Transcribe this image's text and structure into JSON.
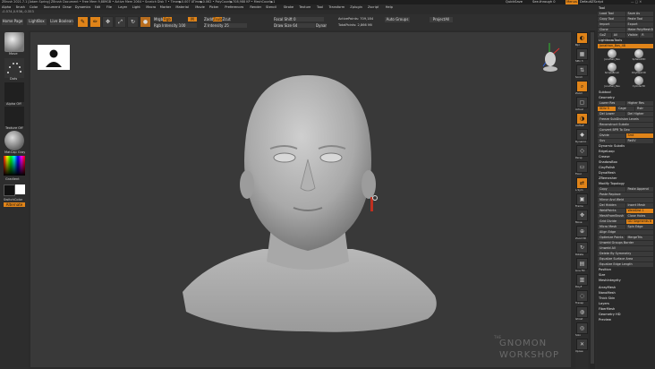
{
  "titlebar": {
    "title": "ZBrush 2021.7.1 [Adam Spring]   ZBrush Document   • Free Mem 9,889GB • Active Mem 2064 • Scratch Disk 7 • Timer▶0.007 ATime▶0.062 • PolyCount▶708,988 KP • MeshCount▶1",
    "quicksave": "QuickSave",
    "see_through": "See-through 0",
    "menus": "Menus",
    "default_script": "DefaultZScript"
  },
  "menubar": {
    "items": [
      "Alpha",
      "Brush",
      "Color",
      "Document",
      "Draw",
      "Dynamics",
      "Edit",
      "File",
      "Layer",
      "Light",
      "Macro",
      "Marker",
      "Material",
      "Movie",
      "Picker",
      "Preferences",
      "Render",
      "Stencil",
      "Stroke",
      "Texture",
      "Tool",
      "Transform",
      "Zplugin",
      "Zscript",
      "Help"
    ]
  },
  "coords": "-0.574,0.936,-0.353",
  "top_toolbar": {
    "home_page": "Home Page",
    "lightbox": "LightBox",
    "live_boolean": "Live Boolean",
    "edit": "Edit",
    "draw": "Draw",
    "move": "Move",
    "scale": "Scale",
    "rotate": "Rotate",
    "mrgb": "Mrgb",
    "rgb": "Rgb",
    "m": "M",
    "zadd": "Zadd",
    "zsub": "Zsub",
    "zcut": "Zcut",
    "rgb_intensity": "Rgb Intensity 100",
    "z_intensity": "Z Intensity 25",
    "focal_shift": "Focal Shift 0",
    "draw_size": "Draw Size 64",
    "dynamic": "Dynamic",
    "active_points": "ActivePoints: 709,184",
    "total_points": "TotalPoints: 2,866 Mil",
    "auto_groups": "Auto Groups",
    "project_all": "ProjectAll"
  },
  "left_shelf": {
    "brush": "Move",
    "stroke": "Dots",
    "alpha": "Alpha Off",
    "texture": "Texture Off",
    "material": "MatCap Gray",
    "gradient": "Gradient",
    "switch_color": "SwitchColor",
    "alternate": "Alternate"
  },
  "right_shelf": {
    "items": [
      "Bpr",
      "SPix 3",
      "Scroll",
      "Zoom",
      "Actual",
      "AAHalf",
      "Dynamic",
      "Persp",
      "Floor",
      "L.Sym",
      "Frame",
      "Move",
      "Zoom3D",
      "Rotate",
      "Line Fill",
      "PolyF",
      "Transp",
      "Ghost",
      "Solo",
      "Xpose"
    ]
  },
  "tool_panel": {
    "title": "Tool",
    "row1": [
      "Load Tool",
      "Save As"
    ],
    "row2": [
      "Copy Tool",
      "Paste Tool"
    ],
    "row3": [
      "Import",
      "Export"
    ],
    "row4": [
      "Clone",
      "Make PolyMesh3D"
    ],
    "row5": [
      "GoZ",
      "All",
      "Visible",
      "R"
    ],
    "lightbox_tools": "Lightbox▸Tools",
    "current_tool": "Jonathan_Bas_48",
    "thumbs": [
      "Jonathan_Bas",
      "SphereD3D",
      "SimpleBrush",
      "PolyMesh3D",
      "Jonathan_Bas",
      "Cylinder3D"
    ],
    "sections": [
      "Subtool",
      "Geometry"
    ],
    "lower_res": "Lower Res",
    "higher_res": "Higher Res",
    "sdiv": "SDiv 5",
    "cage": "Cage",
    "rstr": "Rstr",
    "del_lower": "Del Lower",
    "del_higher": "Del Higher",
    "freeze_subdiv": "Freeze SubDivision Levels",
    "reconstruct": "Reconstruct Subdiv",
    "convert_bpr": "Convert BPR To Geo",
    "divide": "Divide",
    "smt": "Smt",
    "suv": "Suv",
    "reuv": "ReUV",
    "items": [
      "Dynamic Subdiv",
      "EdgeLoop",
      "Crease",
      "ShadowBox",
      "ClayPolish",
      "DynaMesh",
      "ZRemesher",
      "Modify Topology"
    ],
    "copy": "Copy",
    "paste_append": "Paste Append",
    "paste_replace": "Paste Replace",
    "mirror_weld": "Mirror And Weld",
    "delete_hidden": "Del Hidden",
    "insert_mesh": "Insert Mesh",
    "weld_points": "WeldPoints",
    "weld_dist": "WeldDist 1",
    "mesh_from_brush": "MeshFromBrush",
    "close_holes": "Close Holes",
    "grid_divide": "Grid Divide",
    "gd_segments": "GD Segments 8",
    "micro_mesh": "Micro Mesh",
    "spin_edge": "Spin Edge",
    "align_edge": "Align Edge",
    "optimize_points": "Optimize Points",
    "merge_tris": "MergeTris",
    "unweld_groups": "Unweld Groups Border",
    "unweld_all": "Unweld All",
    "delete_symmetry": "Delete By Symmetry",
    "equalize_surface": "Equalize Surface Area",
    "equalize_edge": "Equalize Edge Length",
    "position": "Position",
    "size": "Size",
    "mesh_integrity": "MeshIntegrity",
    "bottom": [
      "ArrayMesh",
      "NanoMesh",
      "Thick Skin",
      "Layers",
      "FiberMesh",
      "Geometry HD",
      "Preview"
    ]
  },
  "watermark": {
    "line1": "THE",
    "line2": "GNOMON",
    "line3": "WORKSHOP"
  },
  "colors": {
    "accent": "#e08419",
    "bg": "#2b2b2b",
    "canvas": "#393939"
  }
}
